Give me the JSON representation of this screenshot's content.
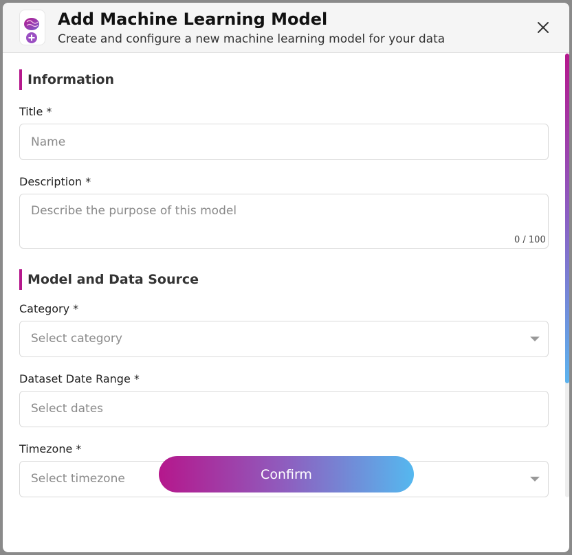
{
  "modal": {
    "title": "Add Machine Learning Model",
    "subtitle": "Create and configure a new machine learning model for your data",
    "close_icon": "close-icon",
    "header_icon": "brain-plus-icon"
  },
  "sections": {
    "information": "Information",
    "model_source": "Model and Data Source"
  },
  "fields": {
    "title": {
      "label": "Title *",
      "placeholder": "Name",
      "value": ""
    },
    "description": {
      "label": "Description *",
      "placeholder": "Describe the purpose of this model",
      "value": "",
      "counter": "0 / 100"
    },
    "category": {
      "label": "Category *",
      "placeholder": "Select category"
    },
    "date_range": {
      "label": "Dataset Date Range *",
      "placeholder": "Select dates"
    },
    "timezone": {
      "label": "Timezone *",
      "placeholder": "Select timezone"
    }
  },
  "actions": {
    "confirm_label": "Confirm"
  },
  "colors": {
    "accent": "#b5178c",
    "gradient_end": "#55b8ef"
  }
}
